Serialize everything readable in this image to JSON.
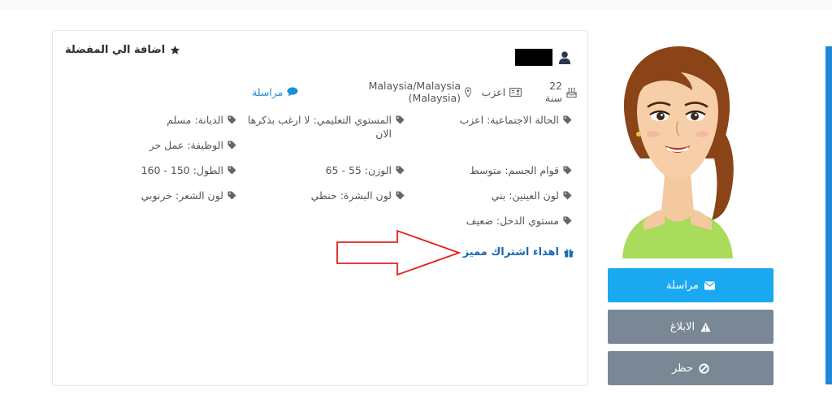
{
  "profile": {
    "add_favorite": "اضافة الي المفضلة",
    "age": "22 سنة",
    "marital_short": "اعزب",
    "location": "Malaysia/Malaysia (Malaysia)",
    "message_link": "مراسلة"
  },
  "details": {
    "marital_status": "الحالة الاجتماعية: اعزب",
    "education_line1": "المستوي التعليمي: لا ارغب بذكرها",
    "education_line2": "الان",
    "religion": "الديانة: مسلم",
    "job": "الوظيفة: عمل حر",
    "body": "قوام الجسم: متوسط",
    "weight": "الوزن: 55 - 65",
    "height": "الطول: 150 - 160",
    "eyes": "لون العينين: بني",
    "skin": "لون البشرة: حنطي",
    "hair": "لون الشعر: خرنوبي",
    "income": "مستوي الدخل: ضعيف"
  },
  "gift_subscription": "اهداء اشتراك مميز",
  "buttons": {
    "message": "مراسلة",
    "report": "الابلاغ",
    "block": "حظر"
  },
  "colors": {
    "link": "#1e8fd6",
    "gift": "#1a6ab0",
    "primary_button": "#1aa9f1",
    "secondary_button": "#7a8895",
    "annotation_arrow": "#e02020",
    "sidebar_accent": "#1e88d6"
  },
  "icons": {
    "user": "user-icon",
    "star": "star-icon",
    "cake": "cake-icon",
    "id_card": "id-card-icon",
    "map_marker": "map-marker-icon",
    "comment": "comment-icon",
    "tag": "tag-icon",
    "gift": "gift-icon",
    "envelope": "envelope-icon",
    "warning": "warning-icon",
    "ban": "ban-icon"
  }
}
